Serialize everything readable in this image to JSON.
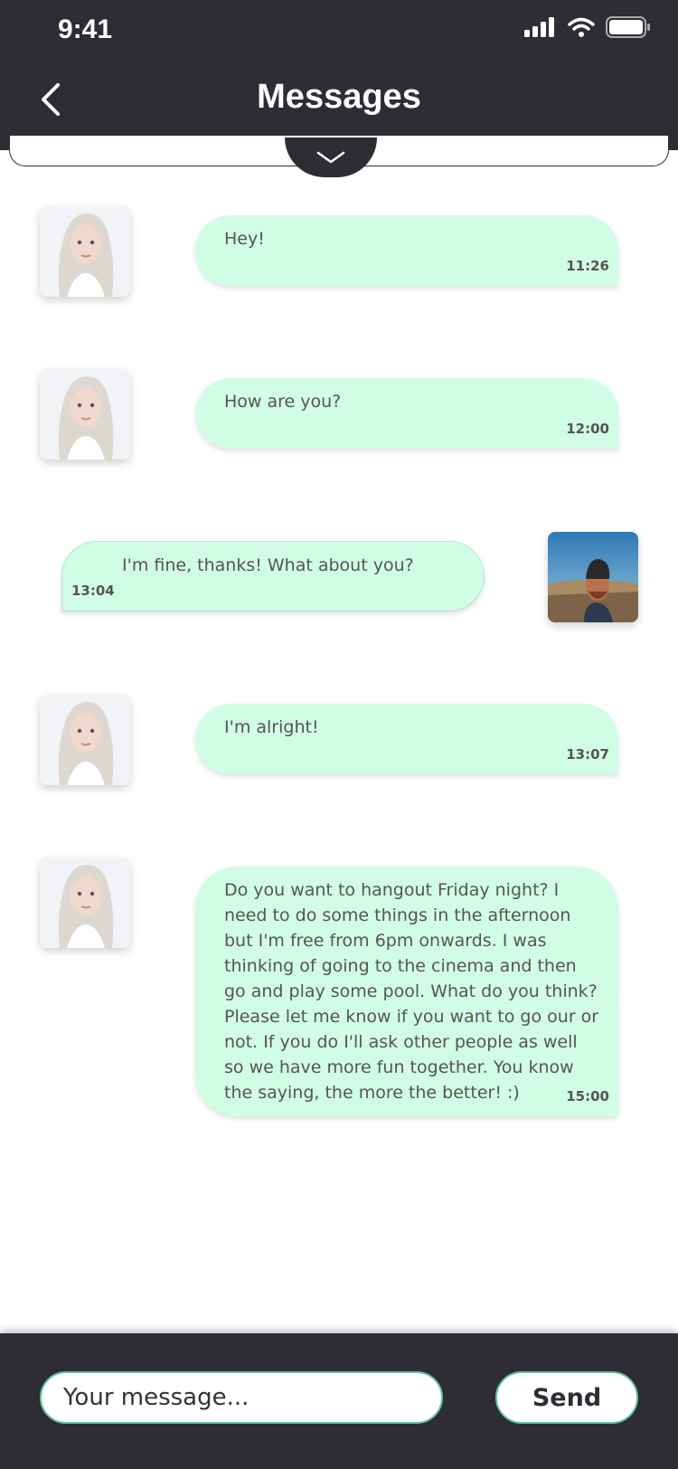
{
  "status_bar": {
    "time": "9:41"
  },
  "header": {
    "title": "Messages"
  },
  "composer": {
    "placeholder": "Your message...",
    "send_label": "Send"
  },
  "messages": [
    {
      "sender": "contact",
      "text": "Hey!",
      "time": "11:26"
    },
    {
      "sender": "contact",
      "text": "How are you?",
      "time": "12:00"
    },
    {
      "sender": "me",
      "text": "I'm fine, thanks! What about you?",
      "time": "13:04"
    },
    {
      "sender": "contact",
      "text": "I'm alright!",
      "time": "13:07"
    },
    {
      "sender": "contact",
      "text": "Do you want to hangout Friday night? I need to do some things in the afternoon but I'm free from 6pm onwards. I was thinking of going to the cinema and then go and play some pool. What do you think? Please let me know if you want to go our or not. If you do I'll ask other people as well so we have more fun together. You know the saying, the more the better! :)",
      "time": "15:00"
    }
  ],
  "colors": {
    "header_bg": "#2f2c33",
    "bubble_bg": "#d1fde6",
    "accent": "#5fc69a"
  }
}
